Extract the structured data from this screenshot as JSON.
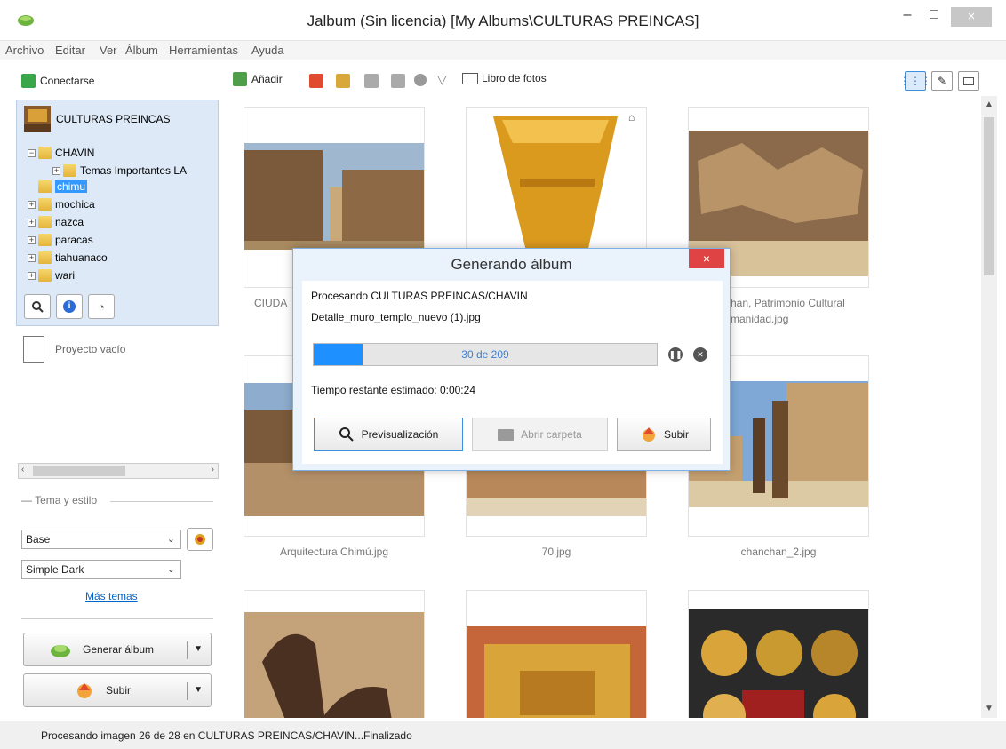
{
  "window": {
    "title": "Jalbum (Sin licencia) [My Albums\\CULTURAS PREINCAS]",
    "minimize_glyph": "–",
    "maximize_glyph": "□",
    "close_glyph": "×"
  },
  "menu": [
    "Archivo",
    "Editar",
    "Ver",
    "Álbum",
    "Herramientas",
    "Ayuda"
  ],
  "left_toolbar": {
    "connect_label": "Conectarse"
  },
  "toolbar": {
    "add_label": "Añadir",
    "photobook_label": "Libro de fotos"
  },
  "tree": {
    "root": "CULTURAS PREINCAS",
    "items": [
      {
        "label": "CHAVIN",
        "expander": "−"
      },
      {
        "label": "Temas Importantes  LA",
        "expander": "+"
      },
      {
        "label": "chimu",
        "expander": ""
      },
      {
        "label": "mochica",
        "expander": "+"
      },
      {
        "label": "nazca",
        "expander": "+"
      },
      {
        "label": "paracas",
        "expander": "+"
      },
      {
        "label": "tiahuanaco",
        "expander": "+"
      },
      {
        "label": "wari",
        "expander": "+"
      }
    ]
  },
  "project": {
    "empty_label": "Proyecto vacío"
  },
  "theme": {
    "legend": "Tema y estilo",
    "theme_value": "Base",
    "style_value": "Simple Dark",
    "more_link": "Más temas"
  },
  "actions": {
    "generate_label": "Generar álbum",
    "upload_label": "Subir"
  },
  "gallery": {
    "captions": [
      "CIUDA",
      "han, Patrimonio Cultural",
      "manidad.jpg",
      "Arquitectura Chimú.jpg",
      "70.jpg",
      "chanchan_2.jpg"
    ]
  },
  "dialog": {
    "title": "Generando álbum",
    "close_glyph": "×",
    "processing_line": "Procesando CULTURAS PREINCAS/CHAVIN",
    "file_line": "Detalle_muro_templo_nuevo (1).jpg",
    "progress_text": "30 de 209",
    "progress_fraction": 0.1435,
    "remaining_line": "Tiempo restante estimado: 0:00:24",
    "preview_label": "Previsualización",
    "open_folder_label": "Abrir carpeta",
    "upload_label": "Subir"
  },
  "status": {
    "text": "Procesando imagen 26 de 28 en CULTURAS PREINCAS/CHAVIN...Finalizado"
  }
}
